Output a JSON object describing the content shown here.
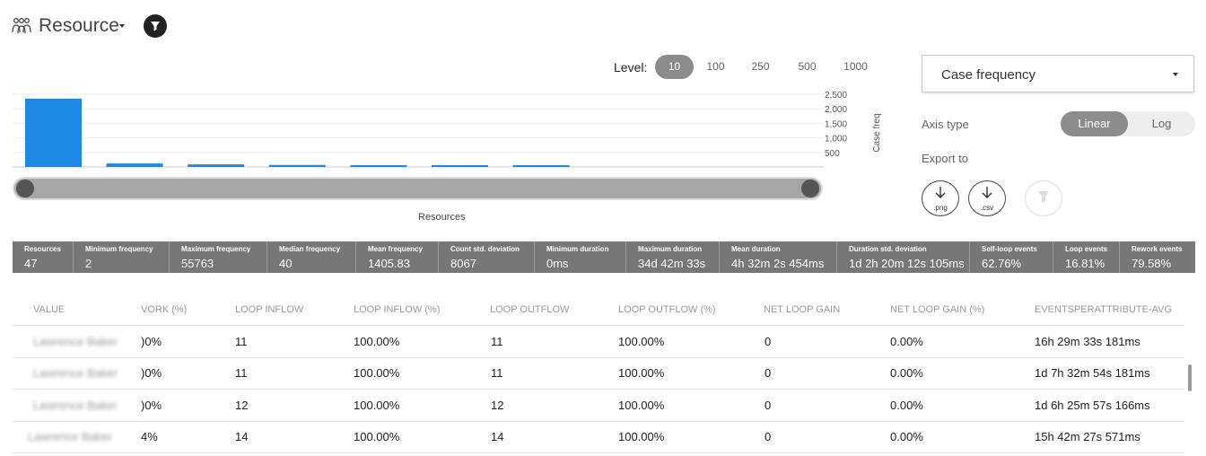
{
  "header": {
    "title": "Resource",
    "icon": "people-icon",
    "filter_icon": "filter-icon"
  },
  "level": {
    "label": "Level:",
    "options": [
      "10",
      "100",
      "250",
      "500",
      "1000"
    ],
    "selected": "10"
  },
  "chart_data": {
    "type": "bar",
    "xlabel": "Resources",
    "ylabel": "Case freq",
    "y_ticks": [
      "2,500",
      "2,000",
      "1,500",
      "1,000",
      "500"
    ],
    "ylim": [
      0,
      2500
    ],
    "grid": true,
    "values": [
      2350,
      120,
      90,
      70,
      50,
      40,
      35
    ],
    "bar_color": "#1e88e5"
  },
  "panel": {
    "metric": "Case frequency",
    "axis_type_label": "Axis type",
    "axis_options": [
      "Linear",
      "Log"
    ],
    "axis_selected": "Linear",
    "export_label": "Export to",
    "export_png": ".png",
    "export_csv": ".csv"
  },
  "stats": [
    {
      "k": "Resources",
      "v": "47"
    },
    {
      "k": "Minimum frequency",
      "v": "2"
    },
    {
      "k": "Maximum frequency",
      "v": "55763"
    },
    {
      "k": "Median frequency",
      "v": "40"
    },
    {
      "k": "Mean frequency",
      "v": "1405.83"
    },
    {
      "k": "Count std. deviation",
      "v": "8067"
    },
    {
      "k": "Minimum duration",
      "v": "0ms"
    },
    {
      "k": "Maximum duration",
      "v": "34d 42m 33s"
    },
    {
      "k": "Mean duration",
      "v": "4h 32m 2s 454ms"
    },
    {
      "k": "Duration std. deviation",
      "v": "1d 2h 20m 12s 105ms"
    },
    {
      "k": "Self-loop events",
      "v": "62.76%"
    },
    {
      "k": "Loop events",
      "v": "16.81%"
    },
    {
      "k": "Rework events",
      "v": "79.58%"
    }
  ],
  "table": {
    "columns": [
      "VALUE",
      "VORK (%)",
      "LOOP INFLOW",
      "LOOP INFLOW (%)",
      "LOOP OUTFLOW",
      "LOOP OUTFLOW (%)",
      "NET LOOP GAIN",
      "NET LOOP GAIN (%)",
      "EVENTSPERATTRIBUTE-AVG"
    ],
    "rows": [
      [
        "Lawrence Baker",
        ")0%",
        "11",
        "100.00%",
        "11",
        "100.00%",
        "0",
        "0.00%",
        "16h 29m 33s 181ms"
      ],
      [
        "Lawrence Baker",
        ")0%",
        "11",
        "100.00%",
        "11",
        "100.00%",
        "0",
        "0.00%",
        "1d 7h 32m 54s 181ms"
      ],
      [
        "Lawrence Baker",
        ")0%",
        "12",
        "100.00%",
        "12",
        "100.00%",
        "0",
        "0.00%",
        "1d 6h 25m 57s 166ms"
      ],
      [
        "Lawrence Baker",
        "4%",
        "14",
        "100.00%",
        "14",
        "100.00%",
        "0",
        "0.00%",
        "15h 42m 27s 571ms"
      ]
    ]
  }
}
